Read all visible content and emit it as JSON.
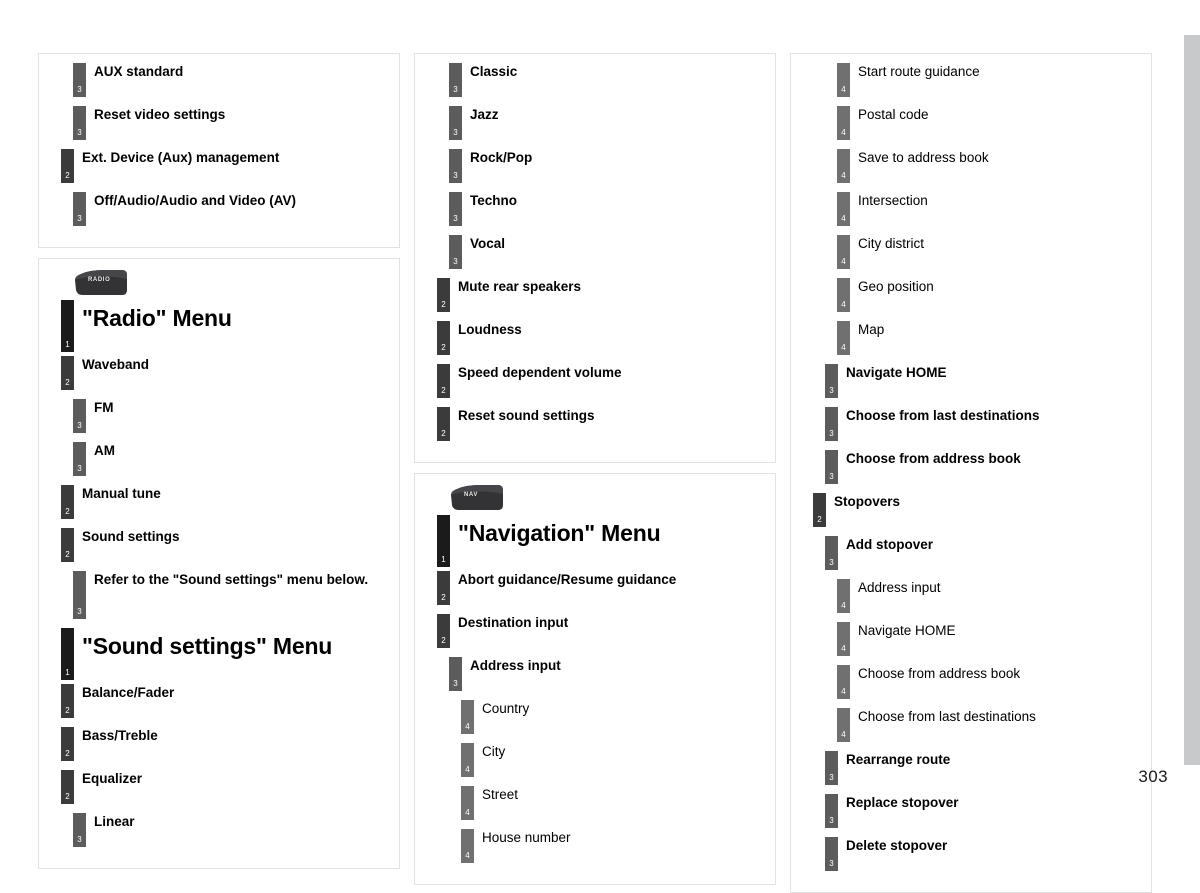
{
  "page": {
    "number": "303",
    "accent_dark": "#1b1b1b",
    "level_colors": {
      "l1": "#1b1b1b",
      "l2": "#3b3b3b",
      "l3": "#5c5c5c",
      "l4": "#707070"
    },
    "edge_bar_color": "#c8c9cb"
  },
  "columns": [
    {
      "panels": [
        {
          "id": "video-aux-panel",
          "tab_icon": null,
          "items": [
            {
              "level": 3,
              "label": "AUX standard"
            },
            {
              "level": 3,
              "label": "Reset video settings"
            },
            {
              "level": 2,
              "label": "Ext. Device (Aux) management"
            },
            {
              "level": 3,
              "label": "Off/Audio/Audio and Video (AV)"
            }
          ]
        },
        {
          "id": "radio-menu-panel",
          "tab_icon": {
            "name": "radio-tab-icon",
            "label": "RADIO"
          },
          "items": [
            {
              "level": 1,
              "label": "\"Radio\" Menu"
            },
            {
              "level": 2,
              "label": "Waveband"
            },
            {
              "level": 3,
              "label": "FM"
            },
            {
              "level": 3,
              "label": "AM"
            },
            {
              "level": 2,
              "label": "Manual tune"
            },
            {
              "level": 2,
              "label": "Sound settings"
            },
            {
              "level": 3,
              "label": "Refer to the \"Sound settings\" menu below.",
              "tall": true
            },
            {
              "level": 1,
              "label": "\"Sound settings\" Menu"
            },
            {
              "level": 2,
              "label": "Balance/Fader"
            },
            {
              "level": 2,
              "label": "Bass/Treble"
            },
            {
              "level": 2,
              "label": "Equalizer"
            },
            {
              "level": 3,
              "label": "Linear"
            }
          ]
        }
      ]
    },
    {
      "panels": [
        {
          "id": "sound-settings-continued-panel",
          "tab_icon": null,
          "items": [
            {
              "level": 3,
              "label": "Classic"
            },
            {
              "level": 3,
              "label": "Jazz"
            },
            {
              "level": 3,
              "label": "Rock/Pop"
            },
            {
              "level": 3,
              "label": "Techno"
            },
            {
              "level": 3,
              "label": "Vocal"
            },
            {
              "level": 2,
              "label": "Mute rear speakers"
            },
            {
              "level": 2,
              "label": "Loudness"
            },
            {
              "level": 2,
              "label": "Speed dependent volume"
            },
            {
              "level": 2,
              "label": "Reset sound settings"
            }
          ]
        },
        {
          "id": "navigation-menu-panel",
          "tab_icon": {
            "name": "nav-tab-icon",
            "label": "NAV"
          },
          "items": [
            {
              "level": 1,
              "label": "\"Navigation\" Menu"
            },
            {
              "level": 2,
              "label": "Abort guidance/Resume guidance"
            },
            {
              "level": 2,
              "label": "Destination input"
            },
            {
              "level": 3,
              "label": "Address input"
            },
            {
              "level": 4,
              "label": "Country"
            },
            {
              "level": 4,
              "label": "City"
            },
            {
              "level": 4,
              "label": "Street"
            },
            {
              "level": 4,
              "label": "House number"
            }
          ]
        }
      ]
    },
    {
      "panels": [
        {
          "id": "navigation-menu-continued-panel",
          "tab_icon": null,
          "items": [
            {
              "level": 4,
              "label": "Start route guidance"
            },
            {
              "level": 4,
              "label": "Postal code"
            },
            {
              "level": 4,
              "label": "Save to address book"
            },
            {
              "level": 4,
              "label": "Intersection"
            },
            {
              "level": 4,
              "label": "City district"
            },
            {
              "level": 4,
              "label": "Geo position"
            },
            {
              "level": 4,
              "label": "Map"
            },
            {
              "level": 3,
              "label": "Navigate HOME"
            },
            {
              "level": 3,
              "label": "Choose from last destinations"
            },
            {
              "level": 3,
              "label": "Choose from address book"
            },
            {
              "level": 2,
              "label": "Stopovers"
            },
            {
              "level": 3,
              "label": "Add stopover"
            },
            {
              "level": 4,
              "label": "Address input"
            },
            {
              "level": 4,
              "label": "Navigate HOME"
            },
            {
              "level": 4,
              "label": "Choose from address book"
            },
            {
              "level": 4,
              "label": "Choose from last destinations"
            },
            {
              "level": 3,
              "label": "Rearrange route"
            },
            {
              "level": 3,
              "label": "Replace stopover"
            },
            {
              "level": 3,
              "label": "Delete stopover"
            }
          ]
        }
      ]
    }
  ]
}
